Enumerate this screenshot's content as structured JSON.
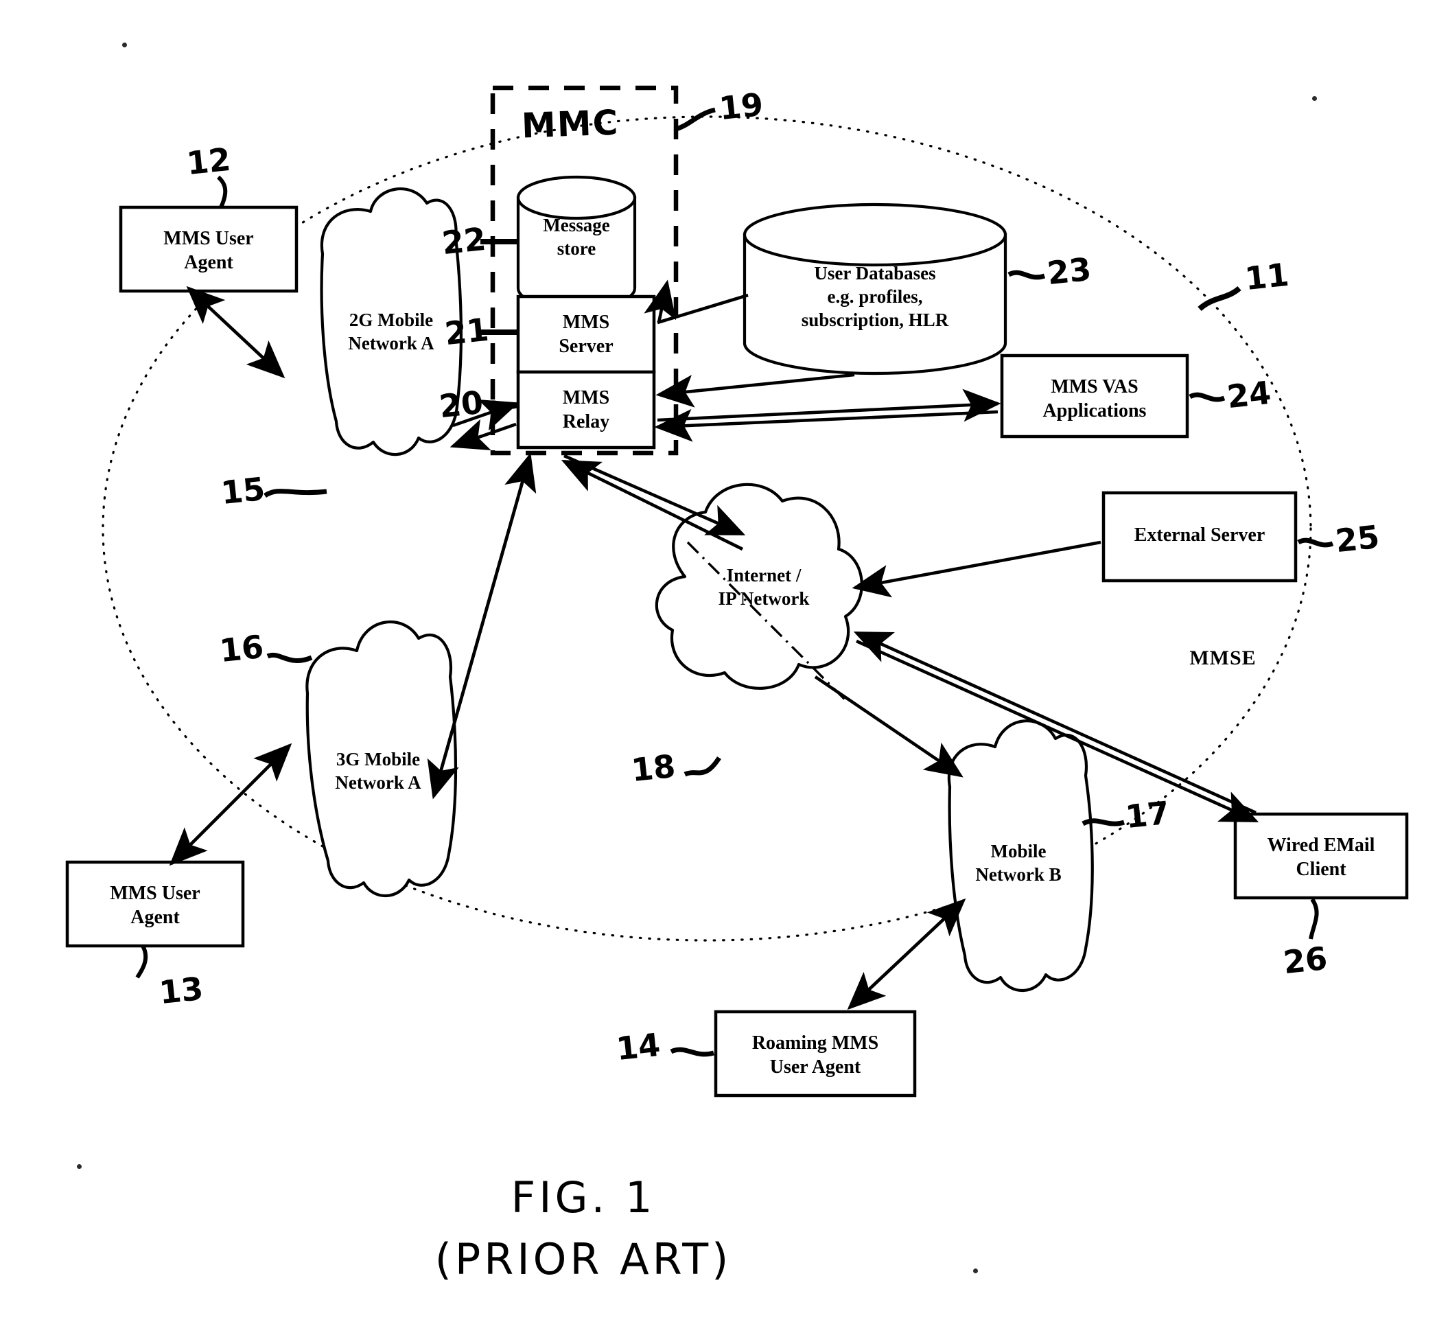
{
  "figure": {
    "caption_line1": "FIG. 1",
    "caption_line2": "(PRIOR ART)",
    "mmc_title": "MMC",
    "mmse_label": "MMSE"
  },
  "nodes": [
    {
      "id": "mms-user-agent-top",
      "label": "MMS User\nAgent",
      "ref": "12",
      "kind": "box"
    },
    {
      "id": "mms-user-agent-bottom",
      "label": "MMS User\nAgent",
      "ref": "13",
      "kind": "box"
    },
    {
      "id": "roaming-mms-user-agent",
      "label": "Roaming MMS\nUser Agent",
      "ref": "14",
      "kind": "box"
    },
    {
      "id": "network-2g",
      "label": "2G Mobile\nNetwork A",
      "ref": "15",
      "kind": "cloud"
    },
    {
      "id": "network-3g",
      "label": "3G Mobile\nNetwork A",
      "ref": "16",
      "kind": "cloud"
    },
    {
      "id": "network-b",
      "label": "Mobile\nNetwork B",
      "ref": "17",
      "kind": "cloud"
    },
    {
      "id": "internet-ip-network",
      "label": "Internet /\nIP Network",
      "ref": "18",
      "kind": "cloud"
    },
    {
      "id": "mmc-boundary",
      "label": "MMC",
      "ref": "19",
      "kind": "dashed-boundary"
    },
    {
      "id": "mms-relay",
      "label": "MMS\nRelay",
      "ref": "20",
      "kind": "box"
    },
    {
      "id": "mms-server",
      "label": "MMS\nServer",
      "ref": "21",
      "kind": "box"
    },
    {
      "id": "message-store",
      "label": "Message\nstore",
      "ref": "22",
      "kind": "cylinder"
    },
    {
      "id": "user-databases",
      "label": "User Databases\ne.g. profiles,\nsubscription, HLR",
      "ref": "23",
      "kind": "cylinder"
    },
    {
      "id": "mms-vas-applications",
      "label": "MMS VAS\nApplications",
      "ref": "24",
      "kind": "box"
    },
    {
      "id": "external-server",
      "label": "External Server",
      "ref": "25",
      "kind": "box"
    },
    {
      "id": "wired-email-client",
      "label": "Wired EMail\nClient",
      "ref": "26",
      "kind": "box"
    },
    {
      "id": "mmse-ellipse",
      "label": "MMSE",
      "ref": "11",
      "kind": "dotted-ellipse"
    }
  ],
  "chart_data": {
    "type": "diagram",
    "title": "FIG. 1 (PRIOR ART) — MMS Architecture",
    "nodes": [
      "MMS User Agent (12)",
      "MMS User Agent (13)",
      "Roaming MMS User Agent (14)",
      "2G Mobile Network A (15)",
      "3G Mobile Network A (16)",
      "Mobile Network B (17)",
      "Internet / IP Network (18)",
      "MMC (19)",
      "MMS Relay (20)",
      "MMS Server (21)",
      "Message store (22)",
      "User Databases e.g. profiles, subscription, HLR (23)",
      "MMS VAS Applications (24)",
      "External Server (25)",
      "Wired EMail Client (26)",
      "MMSE (11)"
    ],
    "edges": [
      {
        "from": "MMS User Agent (12)",
        "to": "2G Mobile Network A (15)",
        "dir": "both"
      },
      {
        "from": "2G Mobile Network A (15)",
        "to": "MMS Relay (20)",
        "dir": "both"
      },
      {
        "from": "MMS User Agent (13)",
        "to": "3G Mobile Network A (16)",
        "dir": "both"
      },
      {
        "from": "3G Mobile Network A (16)",
        "to": "MMS Relay (20)",
        "dir": "both"
      },
      {
        "from": "MMS Relay (20)",
        "to": "Internet / IP Network (18)",
        "dir": "both"
      },
      {
        "from": "MMS Relay (20)",
        "to": "MMS VAS Applications (24)",
        "dir": "both"
      },
      {
        "from": "MMS Server (21)",
        "to": "Message store (22)",
        "dir": "both"
      },
      {
        "from": "User Databases e.g. profiles, subscription, HLR (23)",
        "to": "MMS Relay (20)",
        "dir": "to"
      },
      {
        "from": "MMS Server (21)",
        "to": "User Databases e.g. profiles, subscription, HLR (23)",
        "dir": "to"
      },
      {
        "from": "External Server (25)",
        "to": "Internet / IP Network (18)",
        "dir": "to"
      },
      {
        "from": "Internet / IP Network (18)",
        "to": "Mobile Network B (17)",
        "dir": "to"
      },
      {
        "from": "Mobile Network B (17)",
        "to": "Roaming MMS User Agent (14)",
        "dir": "both"
      },
      {
        "from": "Wired EMail Client (26)",
        "to": "Internet / IP Network (18)",
        "dir": "both"
      }
    ]
  }
}
